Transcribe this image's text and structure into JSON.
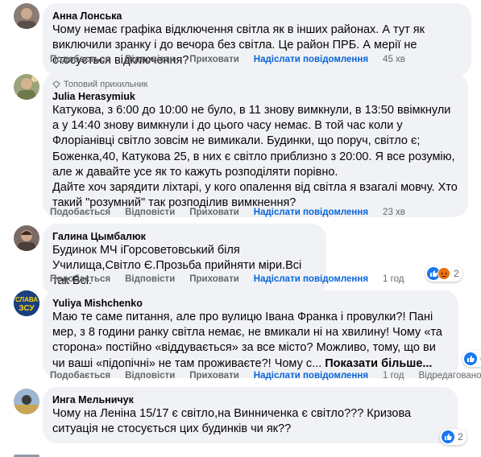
{
  "actions": {
    "like": "Подобається",
    "reply": "Відповісти",
    "hide": "Приховати",
    "send_message": "Надіслати повідомлення"
  },
  "comments": [
    {
      "author": "Анна Лонська",
      "text": "Чому немає графіка відключення світла як в інших районах. А тут як виключили зранку і до вечора без світла. Це район ПРБ. А мерії не стосується відключення?",
      "time": "45 хв"
    },
    {
      "badge": "Топовий прихильник",
      "author": "Julia Herasymiuk",
      "text": "Катукова, з 6:00 до 10:00 не було, в 11 знову вимкнули, в 13:50 ввімкнули а у 14:40 знову вимкнули і до цього часу немає. В той час коли у Флоріанівці світло зовсім не вимикали. Будинки, що поруч, світло є; Боженка,40, Катукова 25, в них є світло приблизно з 20:00. Я все розумію, але ж давайте усе як то кажуть розподіляти порівно.\nДайте хоч зарядити ліхтарі, у кого опалення від світла я взагалі мовчу. Хто такий \"розумний\" так розподілив вимкнення?",
      "time": "23 хв"
    },
    {
      "author": "Галина Цымбалюк",
      "text": "Будинок МЧ іГорсоветовський біля Училища,Світло Є.Прозьба прийняти міри.Всі так Всі.",
      "time": "1 год",
      "reactions": "2"
    },
    {
      "author": "Yuliya Mishchenko",
      "text": "Маю те саме питання, але про вулицю Івана Франка і провулки?! Пані мер, з 8 години ранку світла немає, не вмикали ні на хвилину! Чому «та сторона» постійно «віддувається» за все місто? Можливо, тому, що ви чи ваші «підопічні» не там проживаєте?! Чому с... ",
      "see_more": "Показати більше...",
      "time": "1 год",
      "edited": "Відредаговано",
      "reactions": "6",
      "avatar_text": [
        "СЛАВА",
        "ЗСУ"
      ]
    },
    {
      "author": "Инга Мельничук",
      "text": "Чому на Леніна 15/17 є світло,на Винниченка є світло??? Кризова ситуація не стосується цих будинків чи як??",
      "reactions": "2"
    }
  ],
  "colors": {
    "bubble": "#f0f2f5",
    "link_blue": "#0864d8",
    "meta_gray": "#65676b",
    "like_blue": "#1877f2"
  }
}
